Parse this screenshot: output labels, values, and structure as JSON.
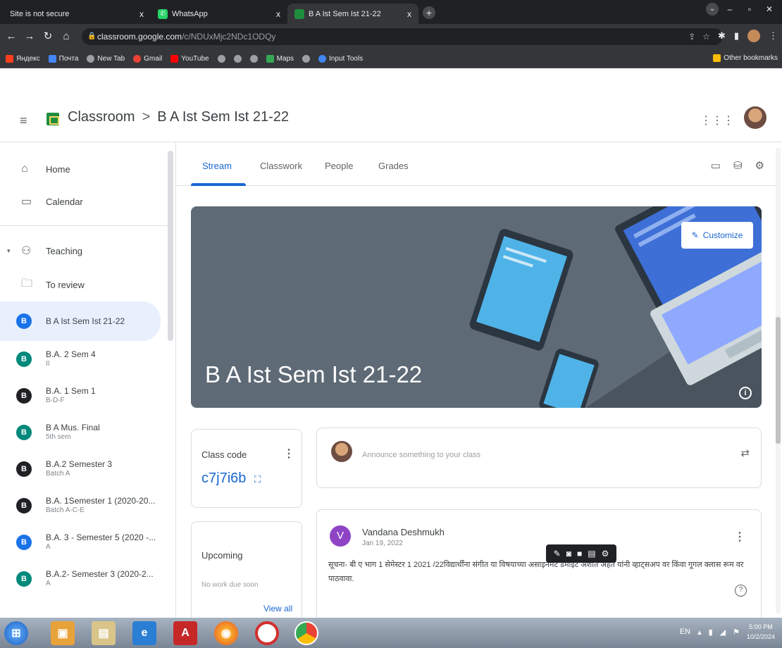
{
  "browser": {
    "tabs": [
      {
        "title": "Site is not secure",
        "close": "x"
      },
      {
        "title": "WhatsApp",
        "close": "x"
      },
      {
        "title": "B A Ist Sem Ist 21-22",
        "close": "x"
      }
    ],
    "new_tab": "+",
    "url_host": "classroom.google.com",
    "url_path": "/c/NDUxMjc2NDc1ODQy",
    "bookmarks": [
      "Яндекс",
      "Почта",
      "New Tab",
      "Gmail",
      "YouTube",
      "Maps",
      "Input Tools"
    ],
    "other_bookmarks": "Other bookmarks"
  },
  "header": {
    "app_name": "Classroom",
    "separator": ">",
    "class_name": "B A Ist Sem Ist 21-22"
  },
  "sidebar": {
    "home": "Home",
    "calendar": "Calendar",
    "teaching": "Teaching",
    "to_review": "To review",
    "classes": [
      {
        "initial": "B",
        "name": "B A Ist Sem Ist 21-22",
        "sub": "",
        "color": "#1a73e8"
      },
      {
        "initial": "B",
        "name": "B.A. 2 Sem 4",
        "sub": "II",
        "color": "#00897b"
      },
      {
        "initial": "B",
        "name": "B.A. 1 Sem 1",
        "sub": "B-D-F",
        "color": "#202124"
      },
      {
        "initial": "B",
        "name": "B A Mus. Final",
        "sub": "5th sem",
        "color": "#00897b"
      },
      {
        "initial": "B",
        "name": "B.A.2 Semester 3",
        "sub": "Batch A",
        "color": "#202124"
      },
      {
        "initial": "B",
        "name": "B.A. 1Semester 1 (2020-20...",
        "sub": "Batch A-C-E",
        "color": "#202124"
      },
      {
        "initial": "B",
        "name": "B.A. 3 - Semester 5 (2020 -...",
        "sub": "A",
        "color": "#1a73e8"
      },
      {
        "initial": "B",
        "name": "B.A.2- Semester 3 (2020-2...",
        "sub": "A",
        "color": "#00897b"
      }
    ]
  },
  "tabs": {
    "stream": "Stream",
    "classwork": "Classwork",
    "people": "People",
    "grades": "Grades"
  },
  "banner": {
    "title": "B A Ist Sem Ist 21-22",
    "customize": "Customize"
  },
  "class_code": {
    "label": "Class code",
    "value": "c7j7i6b"
  },
  "upcoming": {
    "title": "Upcoming",
    "empty": "No work due soon",
    "view_all": "View all"
  },
  "announce": {
    "placeholder": "Announce something to your class"
  },
  "post": {
    "initial": "V",
    "author": "Vandana Deshmukh",
    "date": "Jan 19, 2022",
    "body": "सूचना- बी ए भाग 1 सेमेस्टर 1 2021 /22विद्यार्थींना संगीत या विषयाच्या असाइनमेंट डेमाइंट अशीत अंहेत यांनी व्हाट्सअप वर किंवा गूगल क्लास रूम वर पाठवावा."
  },
  "taskbar": {
    "language": "EN",
    "time": "5:00 PM",
    "date": "10/2/2024"
  },
  "colors": {
    "accent": "#1967d2",
    "banner_bg": "#5e6a75",
    "active_item_bg": "#e8f0fe"
  }
}
